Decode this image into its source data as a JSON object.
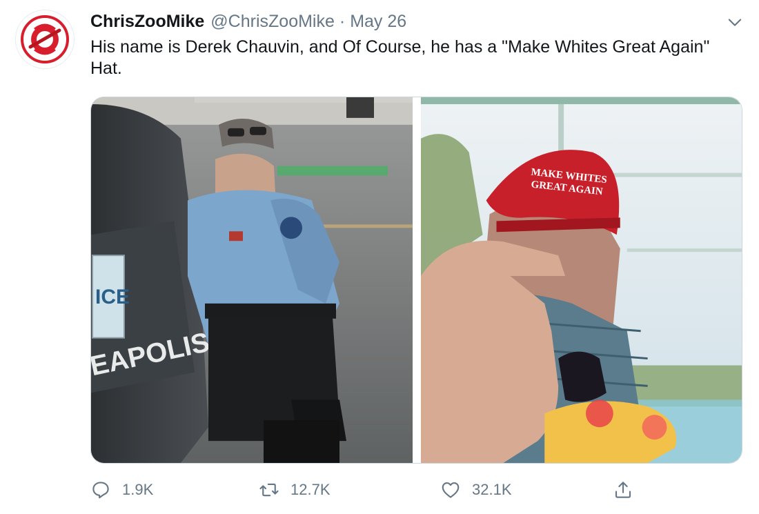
{
  "tweet": {
    "author": {
      "display_name": "ChrisZooMike",
      "handle": "@ChrisZooMike",
      "avatar_icon": "chriszoomike-logo-avatar",
      "avatar_colors": {
        "ring": "#d81e2c",
        "fill": "#ffffff"
      }
    },
    "separator": "·",
    "date": "May 26",
    "text": "His name is Derek Chauvin, and Of Course, he has a \"Make Whites Great Again\" Hat.",
    "menu_icon": "chevron-down-icon",
    "media": {
      "count": 2,
      "photos": [
        {
          "name": "photo-officer-kneeling",
          "plate_text": "ICE",
          "vehicle_text": "EAPOLIS"
        },
        {
          "name": "photo-man-in-red-cap",
          "cap_line_1": "MAKE WHITES",
          "cap_line_2": "GREAT AGAIN"
        }
      ]
    },
    "actions": {
      "reply": {
        "icon": "reply-icon",
        "count": "1.9K"
      },
      "retweet": {
        "icon": "retweet-icon",
        "count": "12.7K"
      },
      "like": {
        "icon": "heart-icon",
        "count": "32.1K"
      },
      "share": {
        "icon": "share-icon"
      }
    }
  },
  "colors": {
    "text_primary": "#14171a",
    "text_secondary": "#657786",
    "border": "#ccd6dd",
    "cap_red": "#c8202a"
  }
}
